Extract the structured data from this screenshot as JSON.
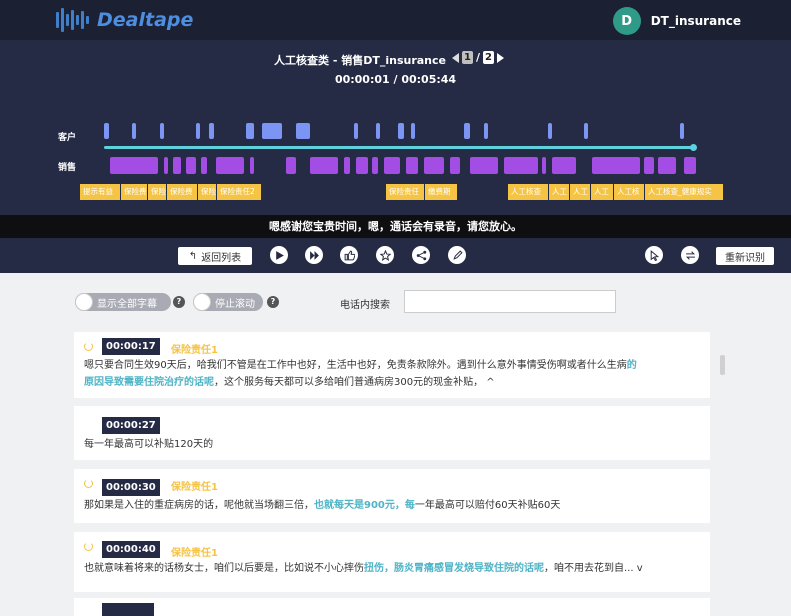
{
  "app": {
    "name": "Dealtape"
  },
  "user": {
    "initial": "D",
    "name": "DT_insurance"
  },
  "player": {
    "title": "人工核查类 - 销售DT_insurance",
    "current_page": "1",
    "page_sep": "/",
    "total_pages": "2",
    "time": "00:00:01 / 00:05:44",
    "customer_label": "客户",
    "sales_label": "销售",
    "tags": [
      "提示有益",
      "保险费",
      "保险",
      "保险费",
      "保险",
      "保险责任2",
      "保险责任",
      "缴费期",
      "人工核查",
      "人工",
      "人工",
      "人工",
      "人工核",
      "人工核查_健康规实"
    ]
  },
  "caption": "嗯感谢您宝贵时间，嗯，通话会有录音，请您放心。",
  "toolbar": {
    "back_label": "返回列表",
    "reidentify_label": "重新识别"
  },
  "controls": {
    "show_all_label": "显示全部字幕",
    "stop_scroll_label": "停止滚动",
    "search_label": "电话内搜索",
    "search_value": ""
  },
  "cards": [
    {
      "time": "00:00:17",
      "category": "保险责任1",
      "t1": "嗯只要合同生效90天后，哈我们不管是在工作中也好，生活中也好，免责条款除外。遇到什么意外事情受伤啊或者什么生病",
      "h1": "的",
      "h2": "原因导致需要住院治疗的话呢",
      "t2": "，这个服务每天都可以多给咱们普通病房300元的现金补贴，",
      "t3": "^"
    },
    {
      "time": "00:00:27",
      "text": "每一年最高可以补贴120天的"
    },
    {
      "time": "00:00:30",
      "category": "保险责任1",
      "t1": "那如果是入住的重症病房的话，呢他就当场翻三倍，",
      "h1": "也就每天是900元，每",
      "t2": "一年最高可以赔付60天补贴60天"
    },
    {
      "time": "00:00:40",
      "category": "保险责任1",
      "t1": "也就意味着将来的话杨女士，咱们以后要是，比如说不小心摔伤",
      "h1": "扭伤，肠炎胃痛感冒发烧导致住院的话呢",
      "t2": "，咱不用去花到自...",
      "t3": "v"
    }
  ]
}
